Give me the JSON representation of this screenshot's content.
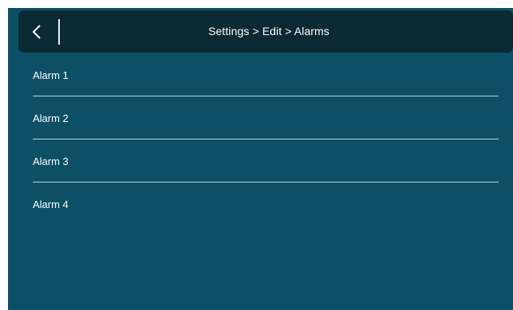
{
  "header": {
    "title": "Settings > Edit > Alarms",
    "back_icon": "chevron-left-icon"
  },
  "alarms": [
    {
      "label": "Alarm 1"
    },
    {
      "label": "Alarm 2"
    },
    {
      "label": "Alarm 3"
    },
    {
      "label": "Alarm 4"
    }
  ],
  "colors": {
    "background": "#0d5066",
    "header": "#0b2a33",
    "text": "#ffffff",
    "divider": "#b9d3db"
  }
}
